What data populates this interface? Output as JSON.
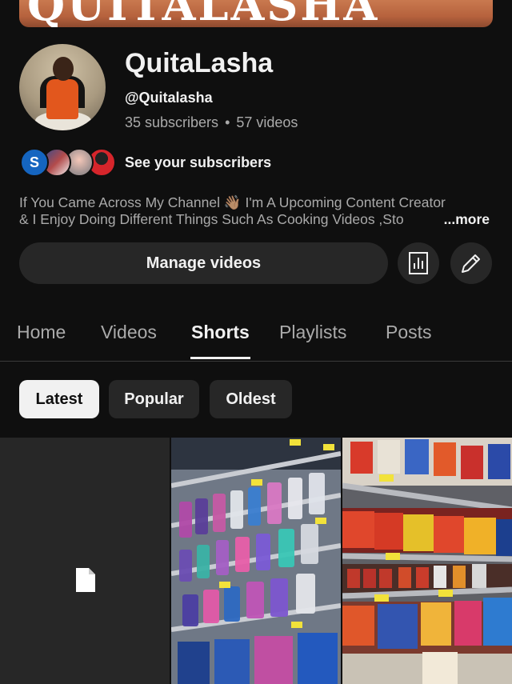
{
  "banner": {
    "text": "QUITALASHA"
  },
  "channel": {
    "name": "QuitaLasha",
    "handle": "@Quitalasha",
    "subscribers": "35 subscribers",
    "separator": "•",
    "videos": "57 videos"
  },
  "subscribers_preview": {
    "first_initial": "S",
    "label": "See your subscribers"
  },
  "description": {
    "line1": "If You Came Across My Channel 👋🏽 I'm A Upcoming Content Creator",
    "line2": "& I Enjoy Doing Different Things Such As Cooking Videos ,Sto",
    "more_label": "...more"
  },
  "actions": {
    "manage_label": "Manage videos",
    "analytics_icon": "analytics-icon",
    "edit_icon": "pencil-icon"
  },
  "tabs": [
    {
      "label": "Home"
    },
    {
      "label": "Videos"
    },
    {
      "label": "Shorts",
      "active": true
    },
    {
      "label": "Playlists"
    },
    {
      "label": "Posts"
    }
  ],
  "filters": [
    {
      "label": "Latest",
      "selected": true
    },
    {
      "label": "Popular"
    },
    {
      "label": "Oldest"
    }
  ],
  "shorts": [
    {
      "thumbnail": "placeholder",
      "icon": "document-icon"
    },
    {
      "thumbnail": "store aisle with razors"
    },
    {
      "thumbnail": "store aisle with chips"
    }
  ],
  "colors": {
    "background": "#0f0f0f",
    "surface": "#272727",
    "text_primary": "#f1f1f1",
    "text_secondary": "#aaaaaa",
    "subscriber_avatar_blue": "#1565c0"
  }
}
